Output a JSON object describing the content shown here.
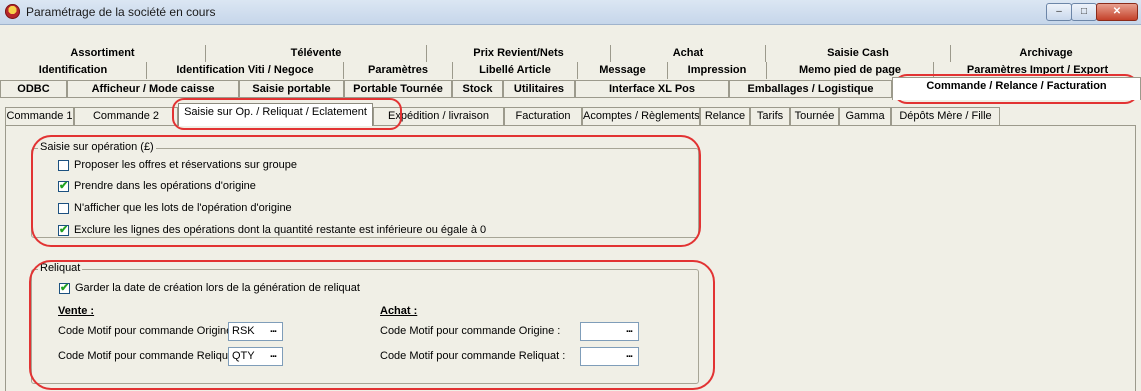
{
  "window": {
    "title": "Paramétrage de la société en cours",
    "min": "–",
    "max": "□",
    "close": "✕"
  },
  "tab_rows": {
    "row1": [
      "Assortiment",
      "Télévente",
      "Prix Revient/Nets",
      "Achat",
      "Saisie Cash",
      "Archivage"
    ],
    "row2": [
      "Identification",
      "Identification Viti / Negoce",
      "Paramètres",
      "Libellé Article",
      "Message",
      "Impression",
      "Memo pied de page",
      "Paramètres Import / Export"
    ],
    "row3": [
      "ODBC",
      "Afficheur / Mode caisse",
      "Saisie portable",
      "Portable Tournée",
      "Stock",
      "Utilitaires",
      "Interface XL Pos",
      "Emballages / Logistique",
      "Commande / Relance / Facturation"
    ]
  },
  "sub_tabs": [
    "Commande 1",
    "Commande 2",
    "Saisie sur Op. / Reliquat / Eclatement",
    "Expédition / livraison",
    "Facturation",
    "Acomptes / Règlements",
    "Relance",
    "Tarifs",
    "Tournée",
    "Gamma",
    "Dépôts Mère / Fille"
  ],
  "saisie": {
    "legend": "Saisie sur opération (£)",
    "options": [
      {
        "label": "Proposer les offres et réservations sur groupe",
        "checked": false
      },
      {
        "label": "Prendre dans les opérations d'origine",
        "checked": true
      },
      {
        "label": "N'afficher que les lots de l'opération d'origine",
        "checked": false
      },
      {
        "label": "Exclure les lignes des opérations dont la quantité restante est inférieure ou égale à 0",
        "checked": true
      }
    ]
  },
  "reliquat": {
    "legend": "Reliquat",
    "garder_label": "Garder la date de création lors de la génération de reliquat",
    "garder_checked": true,
    "vente": {
      "heading": "Vente :",
      "origine_label": "Code Motif pour commande Origine :",
      "origine_value": "RSK",
      "reliquat_label": "Code Motif pour commande Reliquat :",
      "reliquat_value": "QTY"
    },
    "achat": {
      "heading": "Achat :",
      "origine_label": "Code Motif pour commande Origine :",
      "origine_value": "",
      "reliquat_label": "Code Motif pour commande Reliquat :",
      "reliquat_value": ""
    },
    "ellipsis": "..."
  },
  "colors": {
    "annotation": "#e23333",
    "panel_bg": "#f0efe6",
    "titlebar": "#c6d6ea"
  }
}
